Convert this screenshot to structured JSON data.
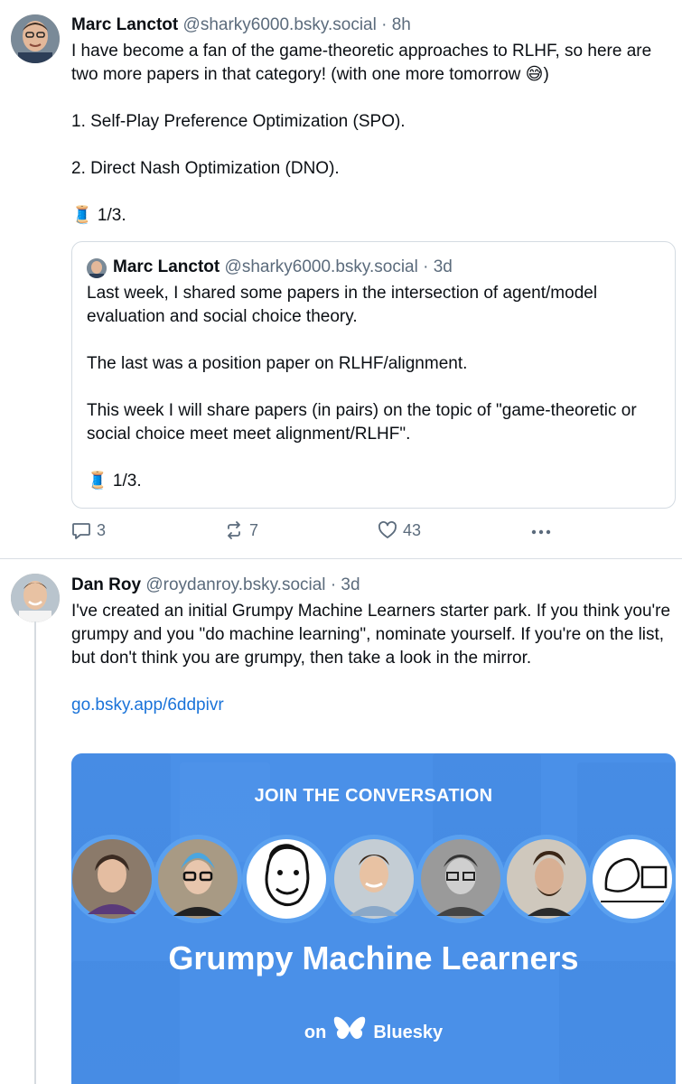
{
  "post1": {
    "author_name": "Marc Lanctot",
    "handle": "@sharky6000.bsky.social",
    "separator": "·",
    "time": "8h",
    "lines": [
      "I have become a fan of the game-theoretic approaches to RLHF, so here are two more papers in that category! (with one more tomorrow 😅)",
      "1. Self-Play Preference Optimization (SPO).",
      "2. Direct Nash Optimization (DNO).",
      "🧵 1/3."
    ],
    "quote": {
      "author_name": "Marc Lanctot",
      "handle": "@sharky6000.bsky.social",
      "separator": "·",
      "time": "3d",
      "lines": [
        "Last week, I shared some papers in the intersection of agent/model evaluation and social choice theory.",
        "The last was a position paper on RLHF/alignment.",
        "This week I will share papers (in pairs) on the topic of \"game-theoretic or social choice meet meet alignment/RLHF\".",
        "🧵 1/3."
      ]
    },
    "actions": {
      "replies": "3",
      "reposts": "7",
      "likes": "43"
    }
  },
  "post2": {
    "author_name": "Dan Roy",
    "handle": "@roydanroy.bsky.social",
    "separator": "·",
    "time": "3d",
    "text": "I've created an initial Grumpy Machine Learners starter park. If you think you're grumpy and you \"do machine learning\", nominate yourself. If you're on the list, but don't think you are grumpy, then take a look in the mirror.",
    "link": "go.bsky.app/6ddpivr",
    "card": {
      "kicker": "JOIN THE CONVERSATION",
      "title": "Grumpy Machine Learners",
      "on": "on",
      "brand": "Bluesky",
      "colors": {
        "bg": "#4a90e8",
        "ring": "#5aa0ef"
      }
    }
  },
  "icons": {
    "reply": "reply-icon",
    "repost": "repost-icon",
    "like": "heart-icon",
    "more": "more-icon",
    "butterfly": "butterfly-icon"
  }
}
